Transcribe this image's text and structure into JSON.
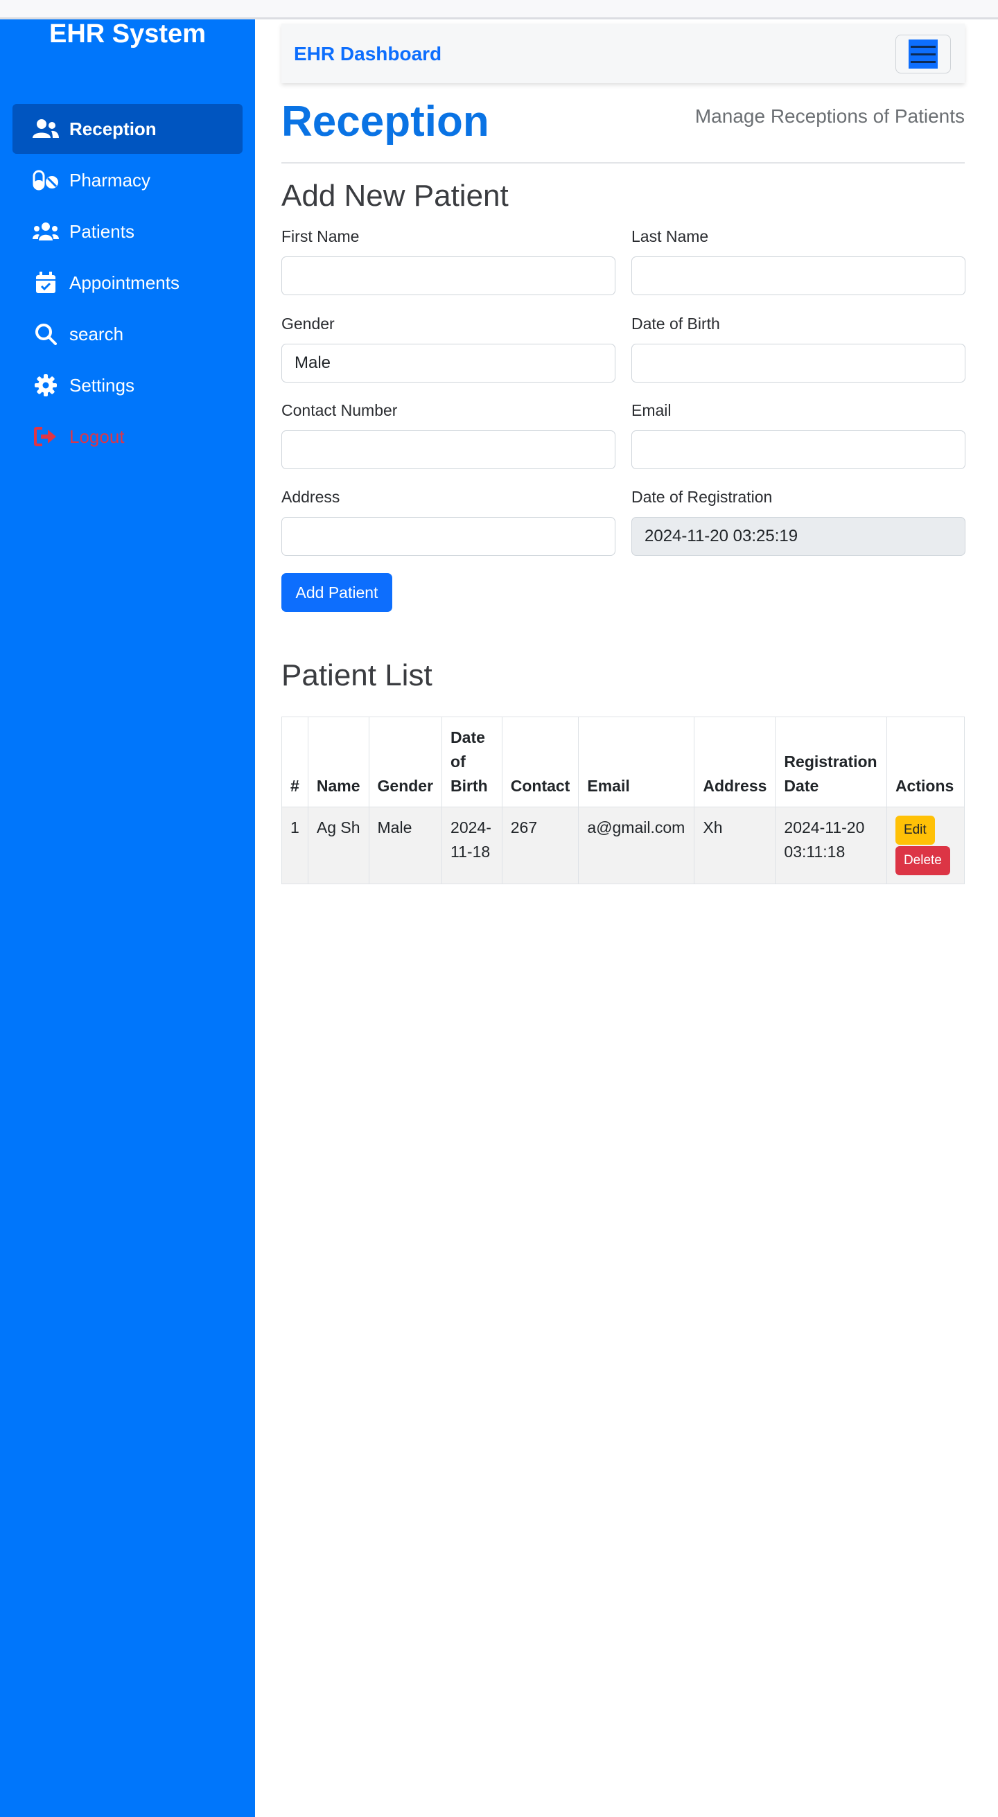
{
  "sidebar": {
    "brand": "EHR System",
    "items": [
      {
        "label": "Reception",
        "icon": "users-icon",
        "active": true
      },
      {
        "label": "Pharmacy",
        "icon": "pills-icon"
      },
      {
        "label": "Patients",
        "icon": "user-group-icon"
      },
      {
        "label": "Appointments",
        "icon": "calendar-check-icon"
      },
      {
        "label": "search",
        "icon": "search-icon"
      },
      {
        "label": "Settings",
        "icon": "gear-icon"
      },
      {
        "label": "Logout",
        "icon": "logout-icon"
      }
    ]
  },
  "header": {
    "title": "EHR Dashboard",
    "menu_icon": "hamburger-menu-icon"
  },
  "page": {
    "title": "Reception",
    "subtitle": "Manage Receptions of Patients"
  },
  "form": {
    "heading": "Add New Patient",
    "first_name_label": "First Name",
    "first_name_value": "",
    "last_name_label": "Last Name",
    "last_name_value": "",
    "gender_label": "Gender",
    "gender_value": "Male",
    "dob_label": "Date of Birth",
    "dob_value": "",
    "contact_label": "Contact Number",
    "contact_value": "",
    "email_label": "Email",
    "email_value": "",
    "address_label": "Address",
    "address_value": "",
    "registration_label": "Date of Registration",
    "registration_value": "2024-11-20 03:25:19",
    "submit_label": "Add Patient"
  },
  "list": {
    "heading": "Patient List",
    "columns": {
      "num": "#",
      "name": "Name",
      "gender": "Gender",
      "dob": "Date of Birth",
      "contact": "Contact",
      "email": "Email",
      "address": "Address",
      "registration": "Registration Date",
      "actions": "Actions"
    },
    "rows": [
      {
        "num": "1",
        "name": "Ag Sh",
        "gender": "Male",
        "dob": "2024-11-18",
        "contact": "267",
        "email": "a@gmail.com",
        "address": "Xh",
        "registration": "2024-11-20 03:11:18",
        "edit_label": "Edit",
        "delete_label": "Delete"
      }
    ]
  },
  "colors": {
    "sidebar": "#0076fb",
    "sidebar_active": "#0055c0",
    "primary": "#0d6efd",
    "warning": "#ffc107",
    "danger": "#dc3545"
  }
}
